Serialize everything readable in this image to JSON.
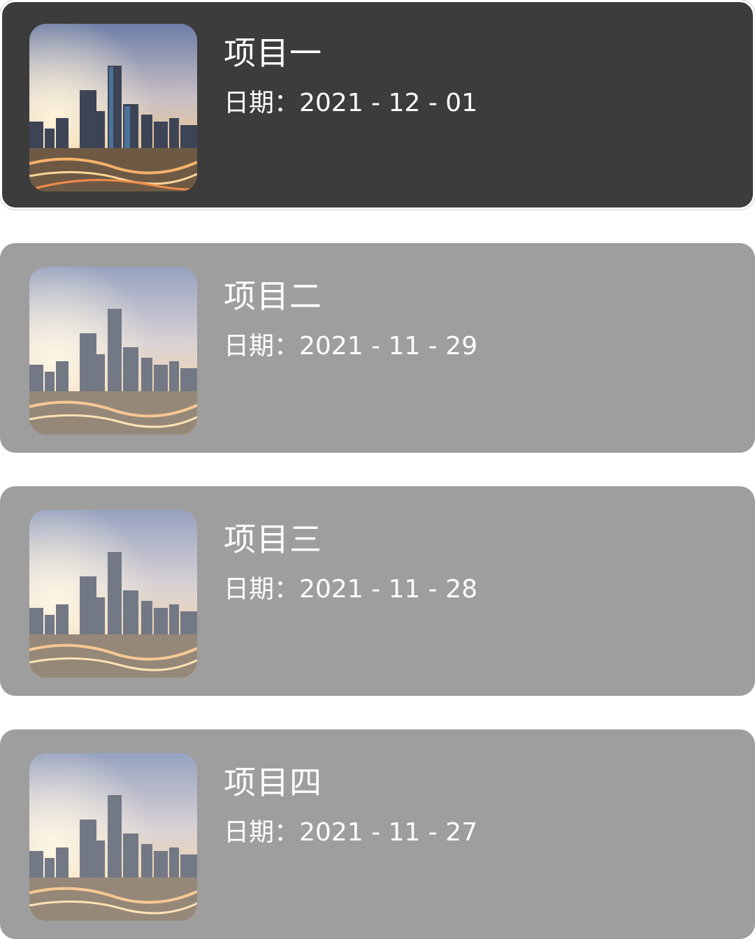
{
  "projects": [
    {
      "title": "项目一",
      "date": "日期：2021 - 12 - 01",
      "selected": true
    },
    {
      "title": "项目二",
      "date": "日期：2021 - 11 - 29",
      "selected": false
    },
    {
      "title": "项目三",
      "date": "日期：2021 - 11 - 28",
      "selected": false
    },
    {
      "title": "项目四",
      "date": "日期：2021 - 11 - 27",
      "selected": false
    }
  ],
  "colors": {
    "selected_card_bg": "#3c3c3c",
    "card_bg": "#9e9e9e",
    "text": "#ffffff"
  },
  "icons": {
    "thumbnail": "city-skyline-image"
  }
}
